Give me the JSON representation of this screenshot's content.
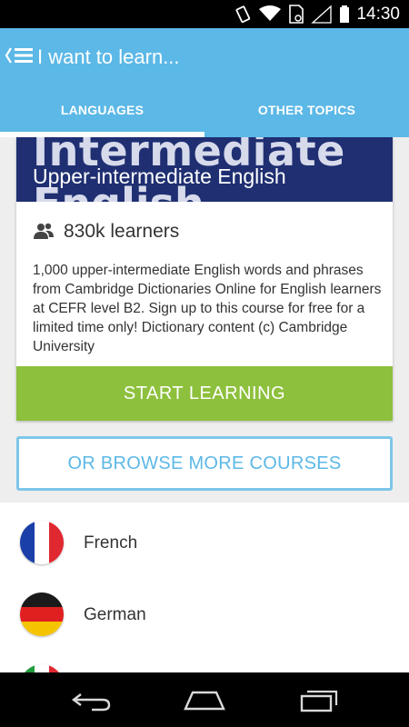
{
  "status_bar": {
    "time": "14:30",
    "icons": [
      "rotate-icon",
      "wifi-icon",
      "sim-icon",
      "signal-icon",
      "battery-icon"
    ]
  },
  "app_bar": {
    "title": "I want to learn...",
    "nav_icon": "menu-back-icon"
  },
  "tabs": [
    {
      "label": "LANGUAGES",
      "selected": true
    },
    {
      "label": "OTHER TOPICS",
      "selected": false
    }
  ],
  "course": {
    "banner_bg_word": "Intermediate",
    "banner_bg_word2": "English",
    "title": "Upper-intermediate English",
    "learners_icon": "group-icon",
    "learners": "830k learners",
    "description": "1,000 upper-intermediate English words and phrases from Cambridge Dictionaries Online for English learners at CEFR level B2. Sign up to this course for free for a limited time only! Dictionary content (c) Cambridge University",
    "start_label": "START LEARNING"
  },
  "browse_label": "OR BROWSE MORE COURSES",
  "languages": [
    {
      "name": "French",
      "flag": "france-flag-icon"
    },
    {
      "name": "German",
      "flag": "germany-flag-icon"
    }
  ],
  "nav_bar": {
    "icons": [
      "back-icon",
      "home-icon",
      "recent-apps-icon"
    ]
  },
  "colors": {
    "accent": "#5cb8e6",
    "start_button": "#8dc03c",
    "banner": "#1f2f72"
  }
}
